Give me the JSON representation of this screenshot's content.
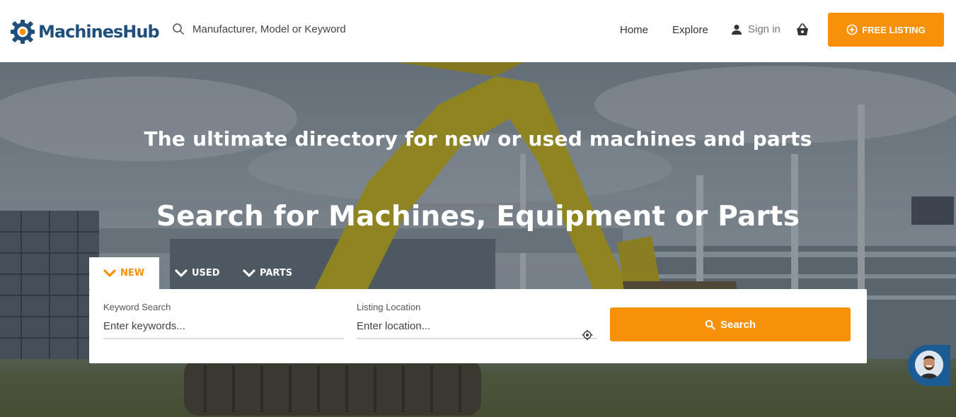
{
  "brand": {
    "name": "MachinesHub",
    "primary_color": "#1f4f7a",
    "accent_color": "#f7910a"
  },
  "header": {
    "search_placeholder": "Manufacturer, Model or Keyword",
    "search_icon": "search-icon",
    "nav": {
      "home": "Home",
      "explore": "Explore",
      "sign_in": "Sign in",
      "user_icon": "user-icon",
      "cart_icon": "basket-icon"
    },
    "cta": {
      "label": "FREE LISTING",
      "icon": "plus-circle-icon"
    }
  },
  "hero": {
    "headline": "The ultimate directory for new or used machines and parts",
    "subhead": "Search for Machines, Equipment or Parts",
    "tabs": [
      {
        "label": "NEW",
        "active": true
      },
      {
        "label": "USED",
        "active": false
      },
      {
        "label": "PARTS",
        "active": false
      }
    ],
    "keyword": {
      "label": "Keyword Search",
      "placeholder": "Enter keywords..."
    },
    "location": {
      "label": "Listing Location",
      "placeholder": "Enter location...",
      "icon": "locate-icon"
    },
    "search_button": "Search"
  },
  "chat": {
    "icon": "chat-avatar"
  }
}
